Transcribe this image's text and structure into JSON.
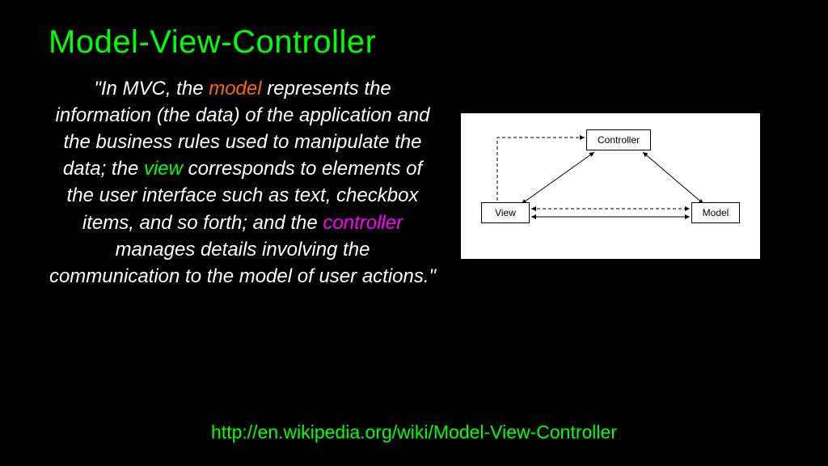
{
  "title": "Model-View-Controller",
  "quote": {
    "pre_model": "\"In MVC, the ",
    "model_word": "model",
    "post_model_pre_view": " represents the information (the data) of the application and the business rules used to manipulate the data; the ",
    "view_word": "view",
    "post_view_pre_controller": " corresponds to elements of the user interface such as text, checkbox items, and so forth; and the ",
    "controller_word": "controller",
    "post_controller": " manages details involving the communication to the model of user actions.\""
  },
  "footer_url": "http://en.wikipedia.org/wiki/Model-View-Controller",
  "diagram": {
    "nodes": {
      "controller": "Controller",
      "view": "View",
      "model": "Model"
    },
    "edges": [
      {
        "from": "View",
        "to": "Controller",
        "style": "dashed",
        "bidirectional": false
      },
      {
        "from": "Controller",
        "to": "View",
        "style": "solid",
        "bidirectional": true
      },
      {
        "from": "Controller",
        "to": "Model",
        "style": "solid",
        "bidirectional": true
      },
      {
        "from": "View",
        "to": "Model",
        "style": "dashed",
        "bidirectional": true
      },
      {
        "from": "View",
        "to": "Model",
        "style": "solid",
        "bidirectional": true
      }
    ]
  }
}
